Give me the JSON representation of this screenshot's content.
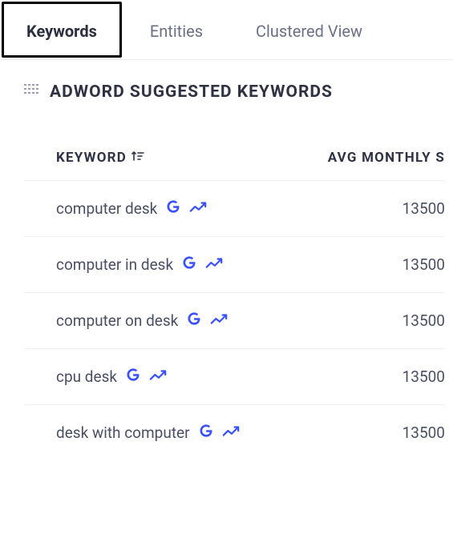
{
  "tabs": [
    {
      "label": "Keywords",
      "active": true
    },
    {
      "label": "Entities",
      "active": false
    },
    {
      "label": "Clustered View",
      "active": false
    }
  ],
  "section": {
    "title": "ADWORD SUGGESTED KEYWORDS"
  },
  "table": {
    "columns": {
      "keyword": "KEYWORD",
      "avg": "AVG MONTHLY S"
    },
    "rows": [
      {
        "keyword": "computer desk",
        "avg": "13500"
      },
      {
        "keyword": "computer in desk",
        "avg": "13500"
      },
      {
        "keyword": "computer on desk",
        "avg": "13500"
      },
      {
        "keyword": "cpu desk",
        "avg": "13500"
      },
      {
        "keyword": "desk with computer",
        "avg": "13500"
      }
    ]
  },
  "icons": {
    "google": "G",
    "trend": "trend",
    "sort": "sort",
    "grid": "grid"
  },
  "colors": {
    "accent": "#3a51ff",
    "text": "#4a4f64",
    "heading": "#2e3243",
    "muted": "#6b7088",
    "border": "#f2f2f6"
  }
}
